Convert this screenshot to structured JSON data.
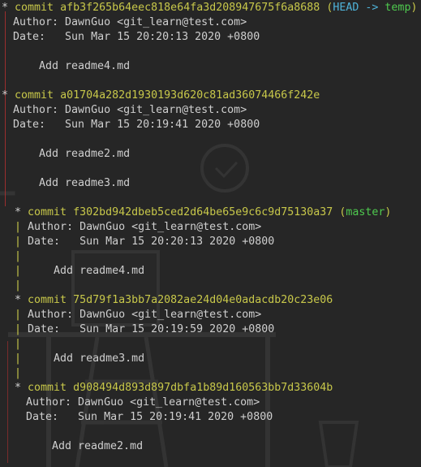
{
  "colors": {
    "background": "#262626",
    "text": "#cfcfcf",
    "commit_hash": "#c8c84a",
    "head_ref": "#4fb3d9",
    "branch_ref": "#4ec94e",
    "graph_line_left": "#b03030"
  },
  "log": {
    "commit1": {
      "star": "*",
      "commit_label": "commit",
      "hash": "afb3f265b64eec818e64fa3d208947675f6a8688",
      "refs_open": "(",
      "head": "HEAD",
      "arrow": "->",
      "branch": "temp",
      "refs_close": ")",
      "author": "Author: DawnGuo <git_learn@test.com>",
      "date": "Date:   Sun Mar 15 20:20:13 2020 +0800",
      "message": "Add readme4.md"
    },
    "commit2": {
      "star": "*",
      "commit_label": "commit",
      "hash": "a01704a282d1930193d620c81ad36074466f242e",
      "author": "Author: DawnGuo <git_learn@test.com>",
      "date": "Date:   Sun Mar 15 20:19:41 2020 +0800",
      "message1": "Add readme2.md",
      "message2": "Add readme3.md"
    },
    "commit3": {
      "star": "*",
      "commit_label": "commit",
      "hash": "f302bd942dbeb5ced2d64be65e9c6c9d75130a37",
      "refs_open": "(",
      "branch": "master",
      "refs_close": ")",
      "author": "Author: DawnGuo <git_learn@test.com>",
      "date": "Date:   Sun Mar 15 20:20:13 2020 +0800",
      "message": "Add readme4.md"
    },
    "commit4": {
      "star": "*",
      "commit_label": "commit",
      "hash": "75d79f1a3bb7a2082ae24d04e0adacdb20c23e06",
      "author": "Author: DawnGuo <git_learn@test.com>",
      "date": "Date:   Sun Mar 15 20:19:59 2020 +0800",
      "message": "Add readme3.md"
    },
    "commit5": {
      "star": "*",
      "commit_label": "commit",
      "hash": "d908494d893d897dbfa1b89d160563bb7d33604b",
      "author": "Author: DawnGuo <git_learn@test.com>",
      "date": "Date:   Sun Mar 15 20:19:41 2020 +0800",
      "message": "Add readme2.md"
    },
    "graph_bar": "|"
  }
}
